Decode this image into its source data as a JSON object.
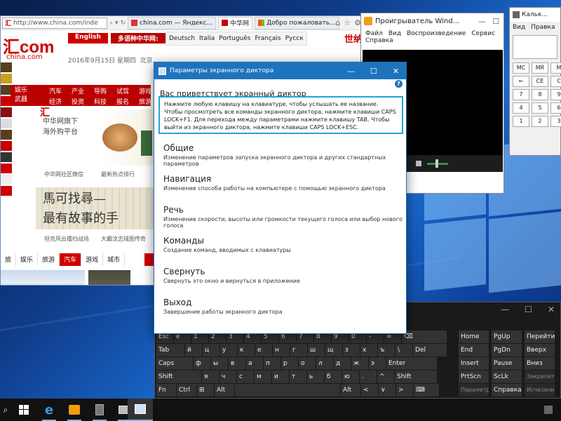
{
  "browser": {
    "address": "http://www.china.com/inde",
    "tabs": [
      {
        "label": "china.com — Яндекс..."
      },
      {
        "label": "中华网"
      },
      {
        "label": "Добро пожаловать..."
      }
    ],
    "site": {
      "logo": "汇com",
      "logo_sub": "china.com",
      "date": "2016年9月15日 星期四",
      "city": "北京",
      "langs_primary": [
        "English",
        "多语种中华网:"
      ],
      "langs_secondary": [
        "Deutsch",
        "Italia",
        "Português",
        "Français",
        "Pусск"
      ],
      "mascot": "世纳",
      "nav_left": [
        "娱乐",
        "武器"
      ],
      "nav_items": [
        "汽车",
        "产业",
        "导购",
        "试驾",
        "游戏",
        "经济",
        "投资",
        "科技",
        "报名",
        "旅游"
      ],
      "banner_hui": "汇",
      "banner_lines": [
        "中华网旗下",
        "海外购平台"
      ],
      "captions": [
        "中华网社区微信",
        "最新热点排行",
        "坦克风云擂扫战场",
        "大霸汶志绒图传奇"
      ],
      "calligraphy": [
        "馬可找尋—",
        "最有故事的手"
      ],
      "categories": [
        "旅",
        "娱乐",
        "旅游",
        "汽车",
        "游戏",
        "城市"
      ]
    }
  },
  "media_player": {
    "title": "Проигрыватель Wind...",
    "menu": [
      "Файл",
      "Вид",
      "Воспроизведение",
      "Сервис",
      "Справка"
    ]
  },
  "calculator": {
    "title": "Кальк...",
    "menu": [
      "Вид",
      "Правка",
      "Сп"
    ],
    "keys": [
      "MC",
      "MR",
      "M",
      "←",
      "CE",
      "C",
      "7",
      "8",
      "9",
      "4",
      "5",
      "6",
      "1",
      "2",
      "3"
    ]
  },
  "narrator": {
    "title": "Параметры экранного диктора",
    "help": "?",
    "welcome": "Вас приветствует экранный диктор",
    "info": "Нажмите любую клавишу на клавиатуре, чтобы услышать ее название. Чтобы просмотреть все команды экранного диктора, нажмите клавиши CAPS LOCK+F1. Для перехода между параметрами нажмите клавишу TAB. Чтобы выйти из экранного диктора, нажмите клавиши CAPS LOCK+ESC.",
    "items": [
      {
        "title": "Общие",
        "desc": "Изменение параметров запуска экранного диктора и других стандартных параметров"
      },
      {
        "title": "Навигация",
        "desc": "Изменение способа работы на компьютере с помощью экранного диктора"
      },
      {
        "title": "Речь",
        "desc": "Изменение скорости, высоты или громкости текущего голоса или выбор нового голоса"
      },
      {
        "title": "Команды",
        "desc": "Создание команд, вводимых с клавиатуры"
      },
      {
        "title": "Свернуть",
        "desc": "Свернуть это окно и вернуться в приложение"
      },
      {
        "title": "Выход",
        "desc": "Завершение работы экранного диктора"
      }
    ]
  },
  "keyboard": {
    "rows": [
      [
        "Esc",
        "ё",
        "1",
        "2",
        "3",
        "4",
        "5",
        "6",
        "7",
        "8",
        "9",
        "0",
        "-",
        "=",
        "⌫"
      ],
      [
        "Tab",
        "й",
        "ц",
        "у",
        "к",
        "е",
        "н",
        "г",
        "ш",
        "щ",
        "з",
        "х",
        "ъ",
        "\\",
        "Del"
      ],
      [
        "Caps",
        "ф",
        "ы",
        "в",
        "а",
        "п",
        "р",
        "о",
        "л",
        "д",
        "ж",
        "э",
        "Enter"
      ],
      [
        "Shift",
        "я",
        "ч",
        "с",
        "м",
        "и",
        "т",
        "ь",
        "б",
        "ю",
        ".",
        "^",
        "Shift"
      ],
      [
        "Fn",
        "Ctrl",
        "⊞",
        "Alt",
        "",
        "Alt",
        "<",
        "∨",
        ">",
        "⌨"
      ]
    ],
    "right_keys": [
      "Home",
      "PgUp",
      "Перейти",
      "End",
      "PgDn",
      "Вверх",
      "Insert",
      "Pause",
      "Вниз",
      "PrtScn",
      "ScLk",
      "Закрепить",
      "Параметры",
      "Справка",
      "Исчезание"
    ]
  },
  "taskbar": {
    "items": [
      "start",
      "edge",
      "media-player",
      "calculator",
      "narrator",
      "keyboard"
    ]
  }
}
